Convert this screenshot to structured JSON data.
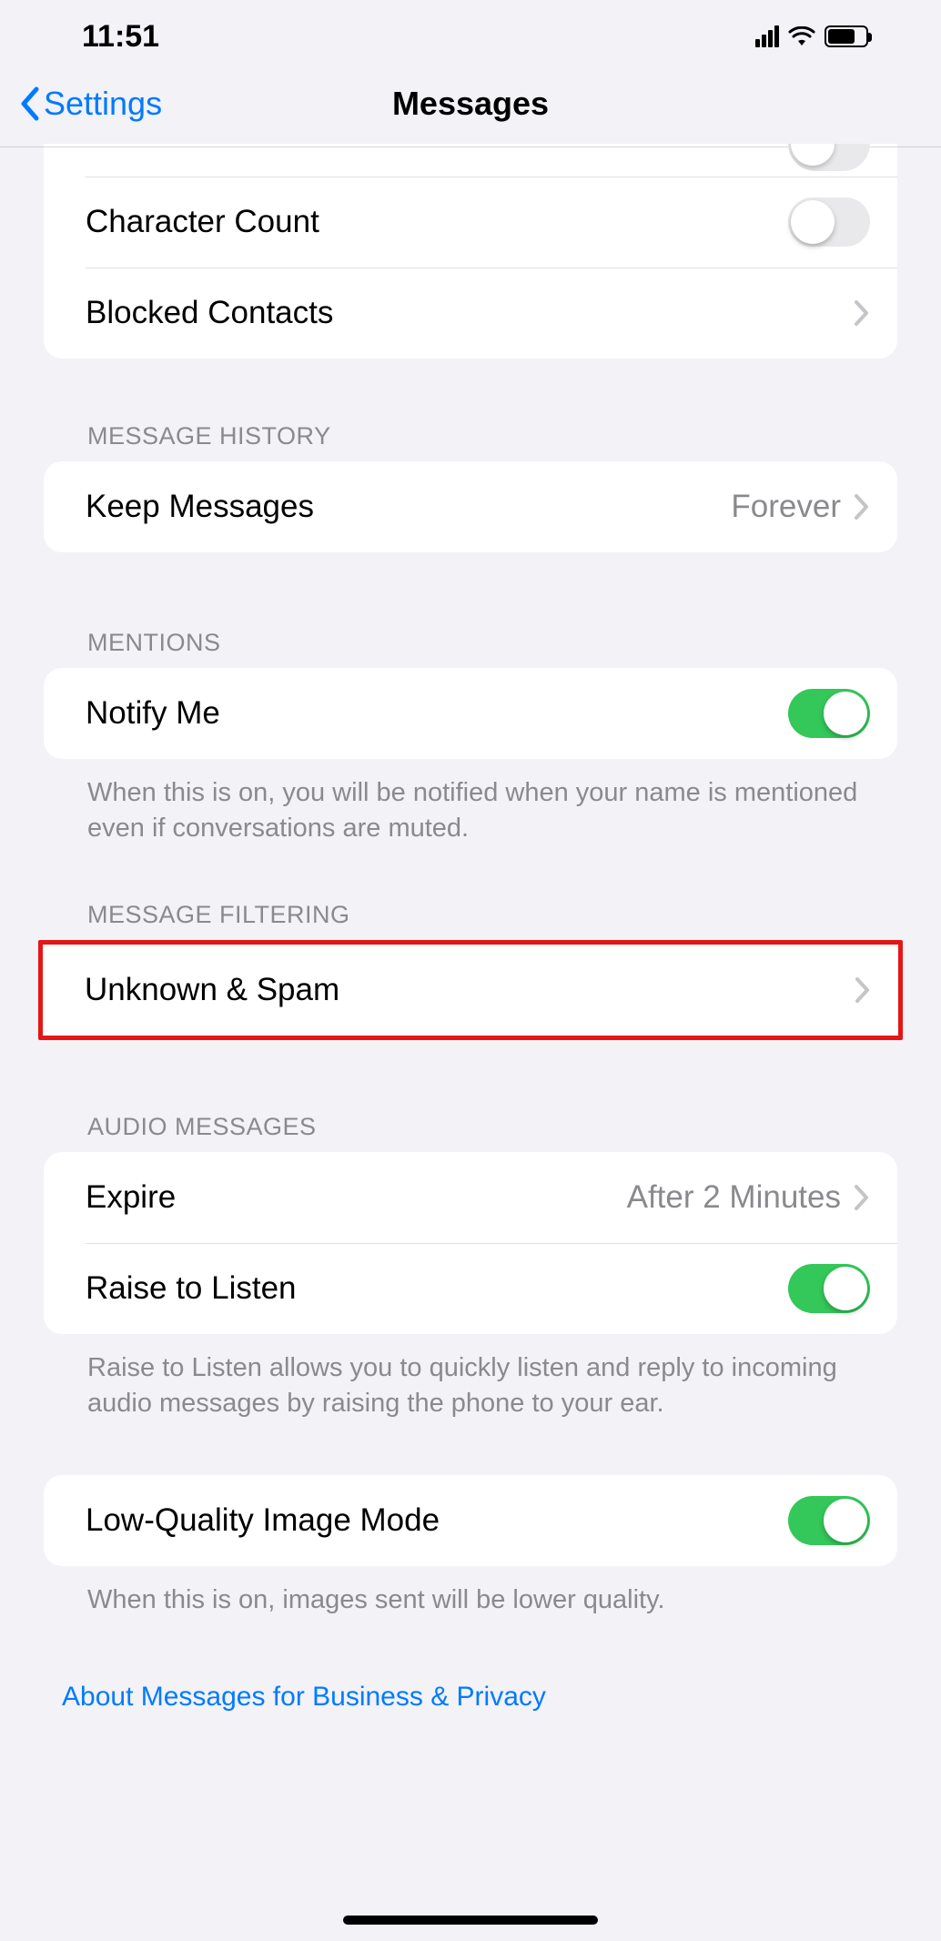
{
  "status": {
    "time": "11:51"
  },
  "nav": {
    "back_label": "Settings",
    "title": "Messages"
  },
  "rows": {
    "char_count": "Character Count",
    "blocked": "Blocked Contacts",
    "keep_label": "Keep Messages",
    "keep_value": "Forever",
    "notify": "Notify Me",
    "unknown": "Unknown & Spam",
    "expire_label": "Expire",
    "expire_value": "After 2 Minutes",
    "raise": "Raise to Listen",
    "lowq": "Low-Quality Image Mode"
  },
  "headers": {
    "history": "MESSAGE HISTORY",
    "mentions": "MENTIONS",
    "filtering": "MESSAGE FILTERING",
    "audio": "AUDIO MESSAGES"
  },
  "footers": {
    "mentions": "When this is on, you will be notified when your name is mentioned even if conversations are muted.",
    "raise": "Raise to Listen allows you to quickly listen and reply to incoming audio messages by raising the phone to your ear.",
    "lowq": "When this is on, images sent will be lower quality."
  },
  "link": "About Messages for Business & Privacy",
  "toggles": {
    "char_count": false,
    "notify": true,
    "raise": true,
    "lowq": true
  }
}
